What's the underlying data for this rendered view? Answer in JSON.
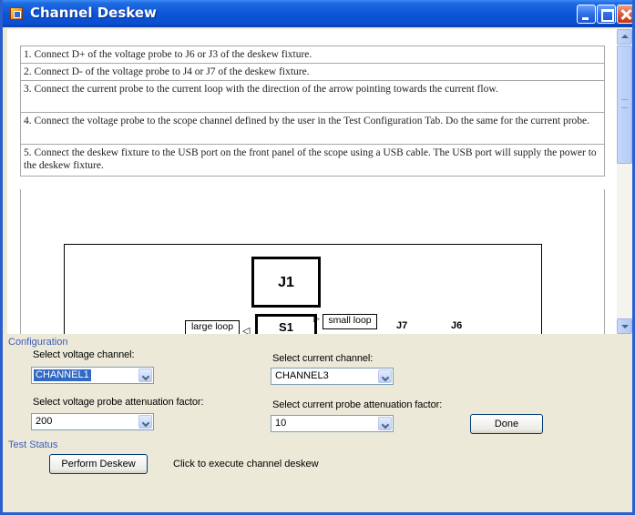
{
  "window": {
    "title": "Channel Deskew"
  },
  "instructions": [
    "1. Connect D+ of the voltage probe to J6 or J3 of the deskew fixture.",
    "2. Connect D- of the voltage probe to J4 or J7 of the deskew fixture.",
    "3. Connect the current probe to the current loop with the direction of the arrow pointing towards the current flow.",
    "4. Connect the voltage probe to the scope channel defined by the user in the Test Configuration Tab. Do the same for the current probe.",
    "5. Connect the deskew fixture to the USB port on the front panel of the scope using a USB cable. The USB port will supply the power to the deskew fixture."
  ],
  "diagram": {
    "j1": "J1",
    "s1": "S1",
    "small_loop": "small loop",
    "large_loop": "large loop",
    "j7": "J7",
    "j6": "J6"
  },
  "configuration": {
    "group_label": "Configuration",
    "voltage_channel_label": "Select voltage channel:",
    "voltage_channel_value": "CHANNEL1",
    "current_channel_label": "Select current channel:",
    "current_channel_value": "CHANNEL3",
    "voltage_atten_label": "Select voltage probe attenuation factor:",
    "voltage_atten_value": "200",
    "current_atten_label": "Select current probe attenuation factor:",
    "current_atten_value": "10",
    "done_label": "Done"
  },
  "test_status": {
    "group_label": "Test Status",
    "perform_label": "Perform Deskew",
    "hint": "Click to execute channel deskew"
  },
  "colors": {
    "titlebar": "#0a55d8",
    "group_label": "#3c5cc0",
    "selection": "#316ac5",
    "dialog_bg": "#ece9d8"
  }
}
